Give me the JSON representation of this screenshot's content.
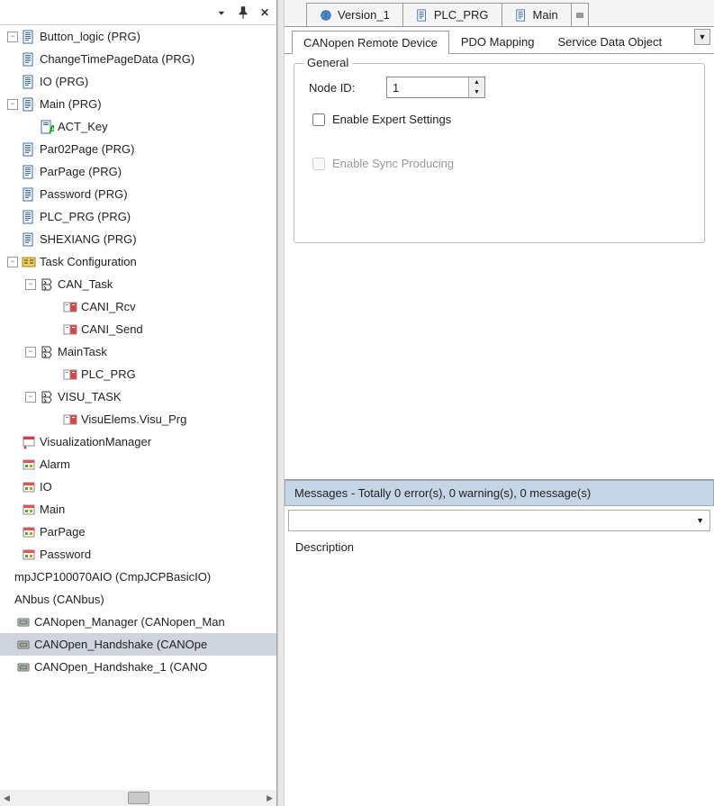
{
  "panel": {
    "titlebar": {
      "dropdown": "▾",
      "pin": "📌",
      "close": "✕"
    }
  },
  "tree": {
    "items": [
      {
        "indent": 6,
        "exp": "−",
        "icon": "prg",
        "label": "Button_logic (PRG)"
      },
      {
        "indent": 6,
        "exp": "",
        "icon": "prg",
        "label": "ChangeTimePageData (PRG)"
      },
      {
        "indent": 6,
        "exp": "",
        "icon": "prg",
        "label": "IO (PRG)"
      },
      {
        "indent": 6,
        "exp": "−",
        "icon": "prg",
        "label": "Main (PRG)"
      },
      {
        "indent": 26,
        "exp": "blank",
        "icon": "act",
        "label": "ACT_Key"
      },
      {
        "indent": 6,
        "exp": "",
        "icon": "prg",
        "label": "Par02Page (PRG)"
      },
      {
        "indent": 6,
        "exp": "",
        "icon": "prg",
        "label": "ParPage (PRG)"
      },
      {
        "indent": 6,
        "exp": "",
        "icon": "prg",
        "label": "Password (PRG)"
      },
      {
        "indent": 6,
        "exp": "",
        "icon": "prg",
        "label": "PLC_PRG (PRG)"
      },
      {
        "indent": 6,
        "exp": "",
        "icon": "prg",
        "label": "SHEXIANG (PRG)"
      },
      {
        "indent": 6,
        "exp": "−",
        "icon": "tcfg",
        "label": "Task Configuration"
      },
      {
        "indent": 26,
        "exp": "−",
        "icon": "task",
        "label": "CAN_Task"
      },
      {
        "indent": 52,
        "exp": "blank",
        "icon": "call",
        "label": "CANI_Rcv"
      },
      {
        "indent": 52,
        "exp": "blank",
        "icon": "call",
        "label": "CANI_Send"
      },
      {
        "indent": 26,
        "exp": "−",
        "icon": "task",
        "label": "MainTask"
      },
      {
        "indent": 52,
        "exp": "blank",
        "icon": "call",
        "label": "PLC_PRG"
      },
      {
        "indent": 26,
        "exp": "−",
        "icon": "task",
        "label": "VISU_TASK"
      },
      {
        "indent": 52,
        "exp": "blank",
        "icon": "call",
        "label": "VisuElems.Visu_Prg"
      },
      {
        "indent": 6,
        "exp": "",
        "icon": "visumgr",
        "label": "VisualizationManager"
      },
      {
        "indent": 6,
        "exp": "",
        "icon": "visu",
        "label": "Alarm"
      },
      {
        "indent": 6,
        "exp": "",
        "icon": "visu",
        "label": "IO"
      },
      {
        "indent": 6,
        "exp": "",
        "icon": "visu",
        "label": "Main"
      },
      {
        "indent": 6,
        "exp": "",
        "icon": "visu",
        "label": "ParPage"
      },
      {
        "indent": 6,
        "exp": "",
        "icon": "visu",
        "label": "Password"
      },
      {
        "indent": 0,
        "exp": "blank",
        "icon": "none",
        "label": "mpJCP100070AIO (CmpJCPBasicIO)"
      },
      {
        "indent": 0,
        "exp": "blank",
        "icon": "none",
        "label": "ANbus (CANbus)"
      },
      {
        "indent": 0,
        "exp": "blank",
        "icon": "dev",
        "label": "CANopen_Manager (CANopen_Man"
      },
      {
        "indent": 0,
        "exp": "blank",
        "icon": "slave",
        "label": "CANOpen_Handshake (CANOpe",
        "selected": true
      },
      {
        "indent": 0,
        "exp": "blank",
        "icon": "slave",
        "label": "CANOpen_Handshake_1 (CANO"
      }
    ]
  },
  "editor_tabs": [
    {
      "icon": "globe",
      "label": "Version_1"
    },
    {
      "icon": "prg",
      "label": "PLC_PRG"
    },
    {
      "icon": "prg",
      "label": "Main"
    }
  ],
  "sub_tabs": [
    {
      "label": "CANopen Remote Device",
      "active": true
    },
    {
      "label": "PDO Mapping"
    },
    {
      "label": "Service Data Object"
    }
  ],
  "form": {
    "legend": "General",
    "node_id_label": "Node ID:",
    "node_id_value": "1",
    "enable_expert_label": "Enable Expert Settings",
    "enable_sync_label": "Enable Sync Producing"
  },
  "messages": {
    "header": "Messages - Totally 0 error(s), 0 warning(s), 0 message(s)",
    "desc_label": "Description"
  }
}
